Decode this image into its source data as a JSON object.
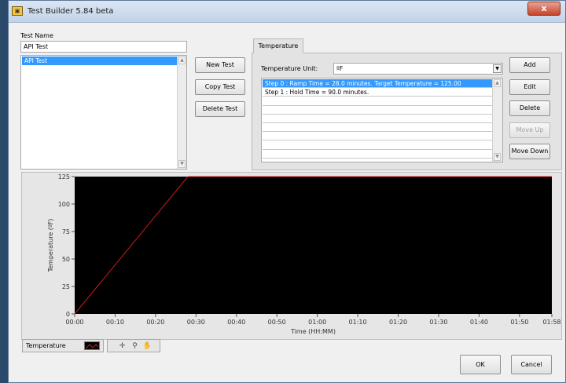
{
  "window": {
    "title": "Test Builder  5.84 beta",
    "close_label": "x"
  },
  "test_name": {
    "label": "Test Name",
    "value": "API Test"
  },
  "tests": [
    "API Test"
  ],
  "buttons": {
    "new_test": "New Test",
    "copy_test": "Copy Test",
    "delete_test": "Delete Test",
    "add": "Add",
    "edit": "Edit",
    "delete": "Delete",
    "move_up": "Move Up",
    "move_down": "Move Down",
    "ok": "OK",
    "cancel": "Cancel"
  },
  "tab": {
    "label": "Temperature"
  },
  "temp_unit": {
    "label": "Temperature Unit:",
    "value": "ºF"
  },
  "steps": [
    "Step 0 : Ramp Time = 28.0 minutes.  Target Temperature = 125.00",
    "Step 1 : Hold Time = 90.0 minutes.",
    "",
    "",
    "",
    "",
    "",
    "",
    ""
  ],
  "legend": {
    "label": "Temperature"
  },
  "icons": {
    "crosshair": "crosshair-icon",
    "zoom": "zoom-icon",
    "pan": "hand-icon"
  },
  "chart_data": {
    "type": "line",
    "xlabel": "Time (HH:MM)",
    "ylabel": "Temperature (ºF)",
    "xlim": [
      0,
      118
    ],
    "ylim": [
      0,
      125
    ],
    "x_tick_values": [
      0,
      10,
      20,
      30,
      40,
      50,
      60,
      70,
      80,
      90,
      100,
      110,
      118
    ],
    "x_tick_labels": [
      "00:00",
      "00:10",
      "00:20",
      "00:30",
      "00:40",
      "00:50",
      "01:00",
      "01:10",
      "01:20",
      "01:30",
      "01:40",
      "01:50",
      "01:58"
    ],
    "y_ticks": [
      0,
      25,
      50,
      75,
      100,
      125
    ],
    "series": [
      {
        "x": [
          0,
          28,
          118
        ],
        "y": [
          0,
          125,
          125
        ],
        "color": "#d11a1a"
      }
    ],
    "background": "#000000",
    "grid": false
  }
}
